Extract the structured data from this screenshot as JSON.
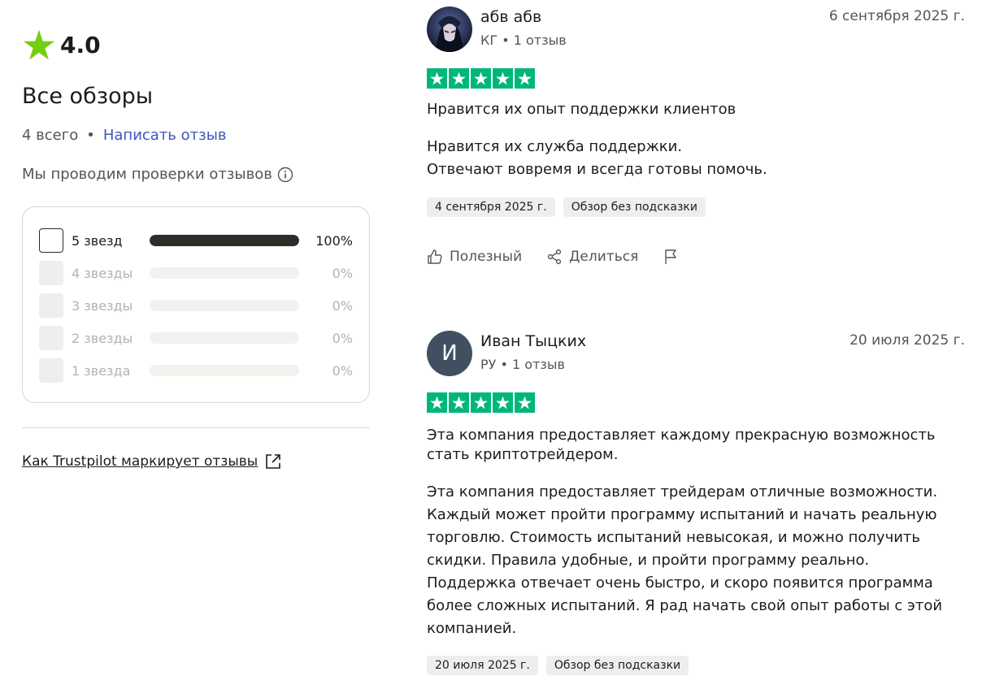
{
  "summary": {
    "rating": "4.0",
    "heading": "Все обзоры",
    "total": "4 всего",
    "separator": "•",
    "write_review": "Написать отзыв",
    "verify_text": "Мы проводим проверки отзывов",
    "distribution": [
      {
        "label": "5 звезд",
        "percent_text": "100%",
        "fraction": 1.0,
        "enabled": true
      },
      {
        "label": "4 звезды",
        "percent_text": "0%",
        "fraction": 0.0,
        "enabled": false
      },
      {
        "label": "3 звезды",
        "percent_text": "0%",
        "fraction": 0.0,
        "enabled": false
      },
      {
        "label": "2 звезды",
        "percent_text": "0%",
        "fraction": 0.0,
        "enabled": false
      },
      {
        "label": "1 звезда",
        "percent_text": "0%",
        "fraction": 0.0,
        "enabled": false
      }
    ],
    "trustpilot_link": "Как Trustpilot маркирует отзывы"
  },
  "reviews": [
    {
      "author": "абв абв",
      "country": "КГ",
      "count": "1 отзыв",
      "date": "6 сентября 2025 г.",
      "stars": 5,
      "title": "Нравится их опыт поддержки клиентов",
      "body": "Нравится их служба поддержки.\nОтвечают вовремя и всегда готовы помочь.",
      "experience_date": "4 сентября 2025 г.",
      "label": "Обзор без подсказки",
      "helpful": "Полезный",
      "share": "Делиться"
    },
    {
      "author": "Иван Тыцких",
      "initial": "И",
      "country": "РУ",
      "count": "1 отзыв",
      "date": "20 июля 2025 г.",
      "stars": 5,
      "title": "Эта компания предоставляет каждому прекрасную возможность стать криптотрейдером.",
      "body": "Эта компания предоставляет трейдерам отличные возможности. Каждый может пройти программу испытаний и начать реальную торговлю. Стоимость испытаний невысокая, и можно получить скидки. Правила удобные, и пройти программу реально. Поддержка отвечает очень быстро, и скоро появится программа более сложных испытаний. Я рад начать свой опыт работы с этой компанией.",
      "experience_date": "20 июля 2025 г.",
      "label": "Обзор без подсказки"
    }
  ],
  "colors": {
    "accent_green": "#00b67a",
    "rating_star": "#73cf11",
    "link_blue": "#3c57bc",
    "bar_fill": "#2c2e27"
  },
  "icons": [
    "star-icon",
    "info-icon",
    "external-link-icon",
    "thumbs-up-icon",
    "share-icon",
    "flag-icon"
  ]
}
